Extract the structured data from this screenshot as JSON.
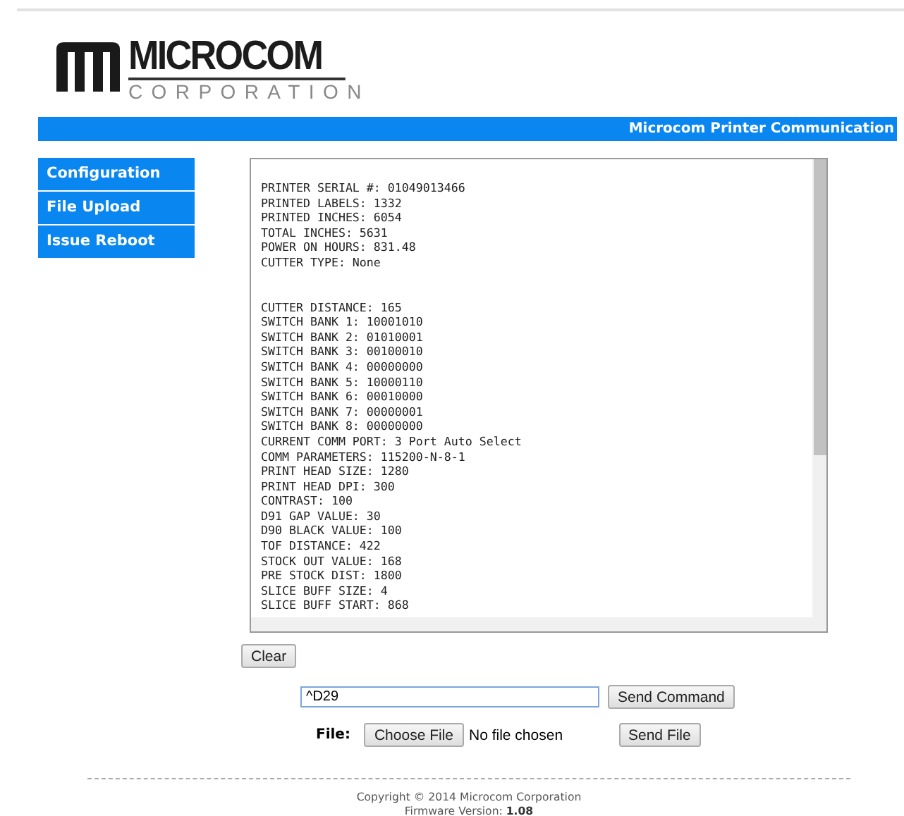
{
  "logo": {
    "name": "MICROCOM",
    "subtitle": "CORPORATION"
  },
  "banner": {
    "title": "Microcom Printer Communication"
  },
  "sidebar": {
    "items": [
      {
        "label": "Configuration"
      },
      {
        "label": "File Upload"
      },
      {
        "label": "Issue Reboot"
      }
    ]
  },
  "console": {
    "groups": [
      [
        "PRINTER SERIAL #: 01049013466",
        "PRINTED LABELS: 1332",
        "PRINTED INCHES: 6054",
        "TOTAL INCHES: 5631",
        "POWER ON HOURS: 831.48",
        "CUTTER TYPE: None"
      ],
      [
        "CUTTER DISTANCE: 165",
        "SWITCH BANK 1: 10001010",
        "SWITCH BANK 2: 01010001",
        "SWITCH BANK 3: 00100010",
        "SWITCH BANK 4: 00000000",
        "SWITCH BANK 5: 10000110",
        "SWITCH BANK 6: 00010000",
        "SWITCH BANK 7: 00000001",
        "SWITCH BANK 8: 00000000",
        "CURRENT COMM PORT: 3 Port Auto Select",
        "COMM PARAMETERS: 115200-N-8-1",
        "PRINT HEAD SIZE: 1280",
        "PRINT HEAD DPI: 300",
        "CONTRAST: 100",
        "D91 GAP VALUE: 30",
        "D90 BLACK VALUE: 100",
        "TOF DISTANCE: 422",
        "STOCK OUT VALUE: 168",
        "PRE STOCK DIST: 1800",
        "SLICE BUFF SIZE: 4",
        "SLICE BUFF START: 868"
      ]
    ]
  },
  "clear_button": "Clear",
  "command": {
    "value": "^D29",
    "button": "Send Command"
  },
  "file": {
    "label": "File:",
    "choose_button": "Choose File",
    "status": "No file chosen",
    "send_button": "Send File"
  },
  "footer": {
    "copyright": "Copyright © 2014 Microcom Corporation",
    "firmware": "Firmware Version: **1.08**"
  }
}
